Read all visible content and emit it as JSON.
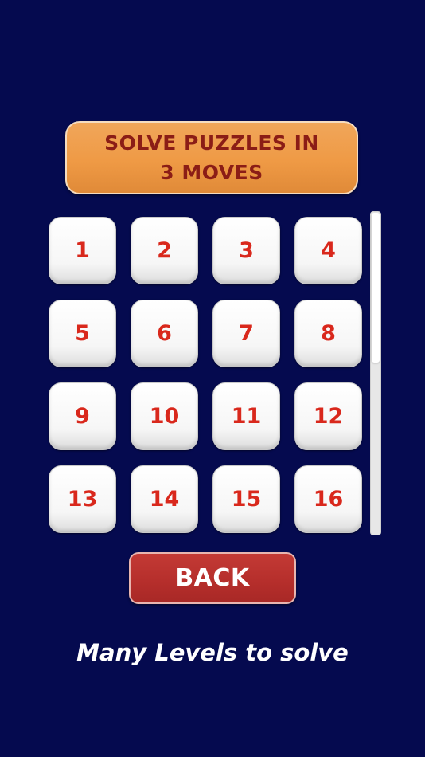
{
  "screen": {
    "background_color": "#050a4f"
  },
  "header": {
    "title": "SOLVE PUZZLES IN\n3 MOVES",
    "banner_color": "#ef9a45",
    "text_color": "#8b1d16"
  },
  "levels": {
    "label_color": "#d9281c",
    "items": [
      {
        "label": "1"
      },
      {
        "label": "2"
      },
      {
        "label": "3"
      },
      {
        "label": "4"
      },
      {
        "label": "5"
      },
      {
        "label": "6"
      },
      {
        "label": "7"
      },
      {
        "label": "8"
      },
      {
        "label": "9"
      },
      {
        "label": "10"
      },
      {
        "label": "11"
      },
      {
        "label": "12"
      },
      {
        "label": "13"
      },
      {
        "label": "14"
      },
      {
        "label": "15"
      },
      {
        "label": "16"
      }
    ]
  },
  "back_button": {
    "label": "BACK",
    "color": "#b52e2b"
  },
  "footer": {
    "tagline": "Many Levels to solve"
  }
}
